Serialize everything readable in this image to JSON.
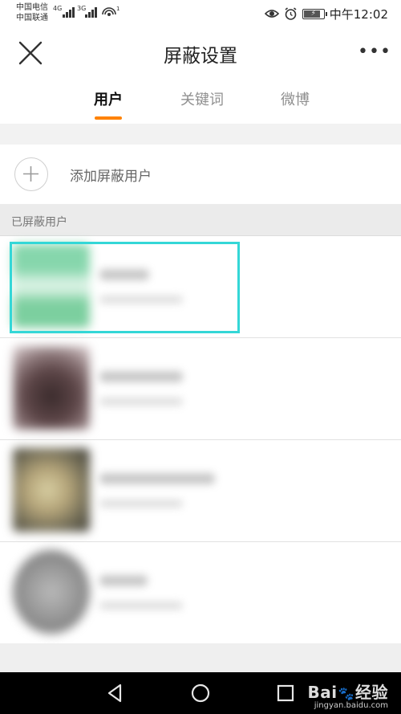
{
  "status_bar": {
    "carrier_1": "中国电信",
    "carrier_2": "中国联通",
    "net_1": "4G",
    "net_2": "3G",
    "time": "中午12:02"
  },
  "header": {
    "title": "屏蔽设置",
    "close_icon": "close-icon",
    "more_icon": "more-horizontal-icon",
    "more_label": "•••"
  },
  "tabs": [
    {
      "label": "用户",
      "active": true
    },
    {
      "label": "关键词",
      "active": false
    },
    {
      "label": "微博",
      "active": false
    }
  ],
  "accent_color": "#ff8200",
  "highlight_color": "#34d7d7",
  "add_row": {
    "label": "添加屏蔽用户",
    "icon": "plus-circle-icon"
  },
  "section": {
    "title": "已屏蔽用户"
  },
  "blocked_users": [
    {
      "avatar_color": "#7fd3a3",
      "highlighted": true
    },
    {
      "avatar_color": "#6b5552",
      "highlighted": false
    },
    {
      "avatar_color": "#a89a6c",
      "highlighted": false
    },
    {
      "avatar_color": "#9b9b9b",
      "highlighted": false
    }
  ],
  "nav_bar": {
    "back_icon": "back-triangle-icon",
    "home_icon": "home-circle-icon",
    "recents_icon": "recents-square-icon"
  },
  "watermark": {
    "brand_left": "Bai",
    "brand_right": "经验",
    "site": "jingyan.baidu.com"
  }
}
